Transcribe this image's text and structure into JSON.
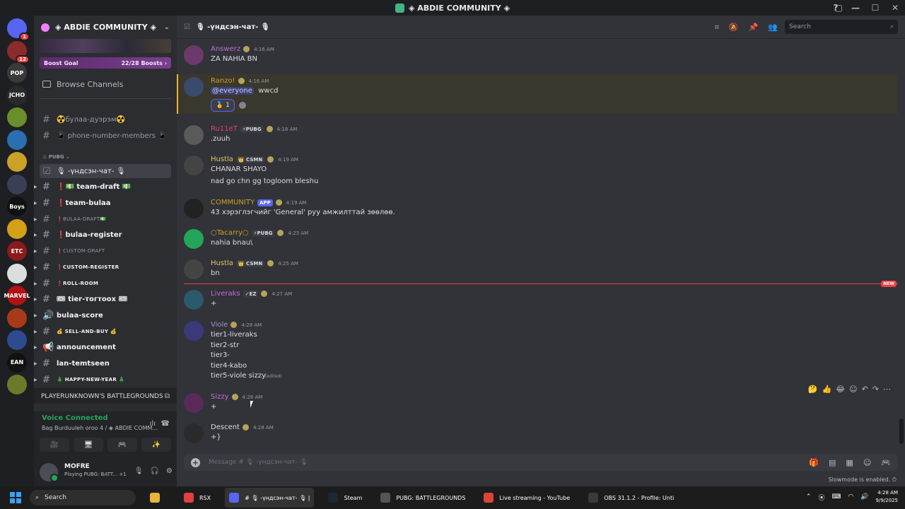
{
  "window": {
    "title": "◈ ABDIE COMMUNITY ◈",
    "controls": [
      "—",
      "☐",
      "✕"
    ]
  },
  "servers": [
    {
      "label": "",
      "color": "#5865f2",
      "badge": "1"
    },
    {
      "label": "",
      "color": "#8b2b2b",
      "badge": "12"
    },
    {
      "label": "POP",
      "color": "#3a3a3a",
      "badge": ""
    },
    {
      "label": "JCHO",
      "color": "#2a2a2a",
      "badge": ""
    },
    {
      "label": "",
      "color": "#6a8f2a",
      "badge": ""
    },
    {
      "label": "",
      "color": "#2a6fb0",
      "badge": ""
    },
    {
      "label": "",
      "color": "#c9a227",
      "badge": ""
    },
    {
      "label": "",
      "color": "#3a3f55",
      "badge": ""
    },
    {
      "label": "Boys",
      "color": "#111111",
      "badge": ""
    },
    {
      "label": "",
      "color": "#d4a017",
      "badge": ""
    },
    {
      "label": "ETC",
      "color": "#8b1a1a",
      "badge": ""
    },
    {
      "label": "",
      "color": "#dddddd",
      "badge": ""
    },
    {
      "label": "MARVEL",
      "color": "#b11313",
      "badge": ""
    },
    {
      "label": "",
      "color": "#a83a1a",
      "badge": ""
    },
    {
      "label": "",
      "color": "#2f4b8f",
      "badge": ""
    },
    {
      "label": "EAN",
      "color": "#111111",
      "badge": ""
    },
    {
      "label": "",
      "color": "#6a7a2a",
      "badge": ""
    }
  ],
  "sidebar": {
    "guild_name": "◈ ABDIE COMMUNITY ◈",
    "boost_goal": "Boost Goal",
    "boost_count": "22/28 Boosts",
    "browse": "Browse Channels",
    "category_pubg": "PUBG",
    "channels": [
      {
        "name": "☢️булаа-дуэрэм☢️",
        "icon": "#",
        "style": "normal"
      },
      {
        "name": "📱 phone-number-members 📱",
        "icon": "#",
        "style": "normal"
      },
      {
        "name": "🎙 -үндсэн-чат- 🎙",
        "icon": "☑",
        "style": "active"
      },
      {
        "name": "❗💵 team-draft 💵",
        "icon": "#",
        "style": "bold"
      },
      {
        "name": "❗team-bulaa",
        "icon": "#",
        "style": "bold"
      },
      {
        "name": "❗BULAA-DRAFT💵",
        "icon": "#",
        "style": "small"
      },
      {
        "name": "❗bulaa-register",
        "icon": "#",
        "style": "bold"
      },
      {
        "name": "❗CUSTOM-DRAFT",
        "icon": "#",
        "style": "small"
      },
      {
        "name": "❗CUSTOM-REGISTER",
        "icon": "#",
        "style": "boldsmall"
      },
      {
        "name": "❗ROLL-ROOM",
        "icon": "#",
        "style": "boldsmall"
      },
      {
        "name": "🎟 tier-тогтоох 🎟",
        "icon": "#",
        "style": "bold"
      },
      {
        "name": "bulaa-score",
        "icon": "🔊",
        "style": "bold"
      },
      {
        "name": "💰 SELL-AND-BUY 💰",
        "icon": "#",
        "style": "boldsmall"
      },
      {
        "name": "announcement",
        "icon": "📢",
        "style": "bold"
      },
      {
        "name": "lan-temtseen",
        "icon": "#",
        "style": "bold"
      },
      {
        "name": "🎄 HAPPY-NEW-YEAR 🎄",
        "icon": "#",
        "style": "boldsmall"
      }
    ],
    "game_bar": "PLAYERUNKNOWN'S BATTLEGROUNDS",
    "voice": {
      "status": "Voice Connected",
      "channel": "Bag Burduuleh oroo 4 / ◈ ABDIE COMM...",
      "btn1": "🎥",
      "btn2": "🖥",
      "btn3": "🎮",
      "btn4": "✨"
    },
    "user": {
      "name": "MOFRE",
      "status": "Playing PUBG: BATT...  +1"
    }
  },
  "chat": {
    "channel_name": "🎙 -үндсэн-чат- 🎙",
    "search_placeholder": "Search",
    "messages": [
      {
        "author": "Answerz",
        "color": "#c26bd9",
        "tag": "",
        "time": "4:16 AM",
        "lines": [
          "ZA NAHIA BN"
        ],
        "avatar": "#6b3a6b"
      },
      {
        "author": "Ranzo!",
        "color": "#c9a227",
        "tag": "",
        "time": "4:16 AM",
        "lines": [
          "@everyone  wwcd"
        ],
        "avatar": "#3a4a6b"
      },
      {
        "author": "Ru11eT",
        "color": "#d9446f",
        "tag": "⚡PUBG",
        "time": "4:18 AM",
        "lines": [
          ".zuuh"
        ],
        "avatar": "#5a5a5a"
      },
      {
        "author": "Hustla",
        "color": "#e0c66a",
        "tag": "👑 CSMN",
        "time": "4:19 AM",
        "lines": [
          "CHANAR SHAYO",
          "nad go chn gg togloom bleshu"
        ],
        "avatar": "#444444"
      },
      {
        "author": "COMMUNITY",
        "color": "#c9a227",
        "tag": "APP",
        "time": "4:19 AM",
        "lines": [
          "43 хэрэглэгчийг 'General' руу амжилттай зөөлөө."
        ],
        "avatar": "#222222"
      },
      {
        "author": "○Tacarry○",
        "color": "#c9a227",
        "tag": "⚡PUBG",
        "time": "4:23 AM",
        "lines": [
          "nahia bnau\\"
        ],
        "avatar": "#23a55a"
      },
      {
        "author": "Hustla",
        "color": "#e0c66a",
        "tag": "👑 CSMN",
        "time": "4:25 AM",
        "lines": [
          "bn"
        ],
        "avatar": "#444444"
      },
      {
        "author": "Liveraks",
        "color": "#c26bd9",
        "tag": "✓EZ",
        "time": "4:27 AM",
        "lines": [
          "+"
        ],
        "avatar": "#2a5a6b"
      },
      {
        "author": "Viole",
        "color": "#a58dd6",
        "tag": "",
        "time": "4:28 AM",
        "lines": [
          "tier1-liveraks",
          "tier2-str",
          "tier3-",
          "tier4-kabo",
          "tier5-viole sizzy"
        ],
        "edited": "(edited)",
        "avatar": "#3a3a7a"
      },
      {
        "author": "Sizzy",
        "color": "#c26bd9",
        "tag": "",
        "time": "4:28 AM",
        "lines": [
          "+"
        ],
        "avatar": "#5a2a5a"
      },
      {
        "author": "Descent",
        "color": "#dbdee1",
        "tag": "",
        "time": "4:28 AM",
        "lines": [
          "+}"
        ],
        "avatar": "#2a2a2a"
      }
    ],
    "reaction_count": "1",
    "new_label": "NEW",
    "composer_placeholder": "Message # 🎙 -үндсэн-чат- 🎙",
    "slowmode": "Slowmode is enabled."
  },
  "taskbar": {
    "search": "Search",
    "apps": [
      {
        "label": "RSX",
        "color": "#e04040",
        "active": false
      },
      {
        "label": "# 🎙 -үндсэн-чат- 🎙 |",
        "color": "#5865f2",
        "active": true
      },
      {
        "label": "Steam",
        "color": "#1b2838",
        "active": false
      },
      {
        "label": "PUBG: BATTLEGROUNDS",
        "color": "#555555",
        "active": false
      },
      {
        "label": "Live streaming - YouTube",
        "color": "#db4437",
        "active": false
      },
      {
        "label": "OBS 31.1.2 - Profile: Unti",
        "color": "#3a3a3a",
        "active": false
      }
    ],
    "time": "4:28 AM",
    "date": "9/9/2025"
  }
}
